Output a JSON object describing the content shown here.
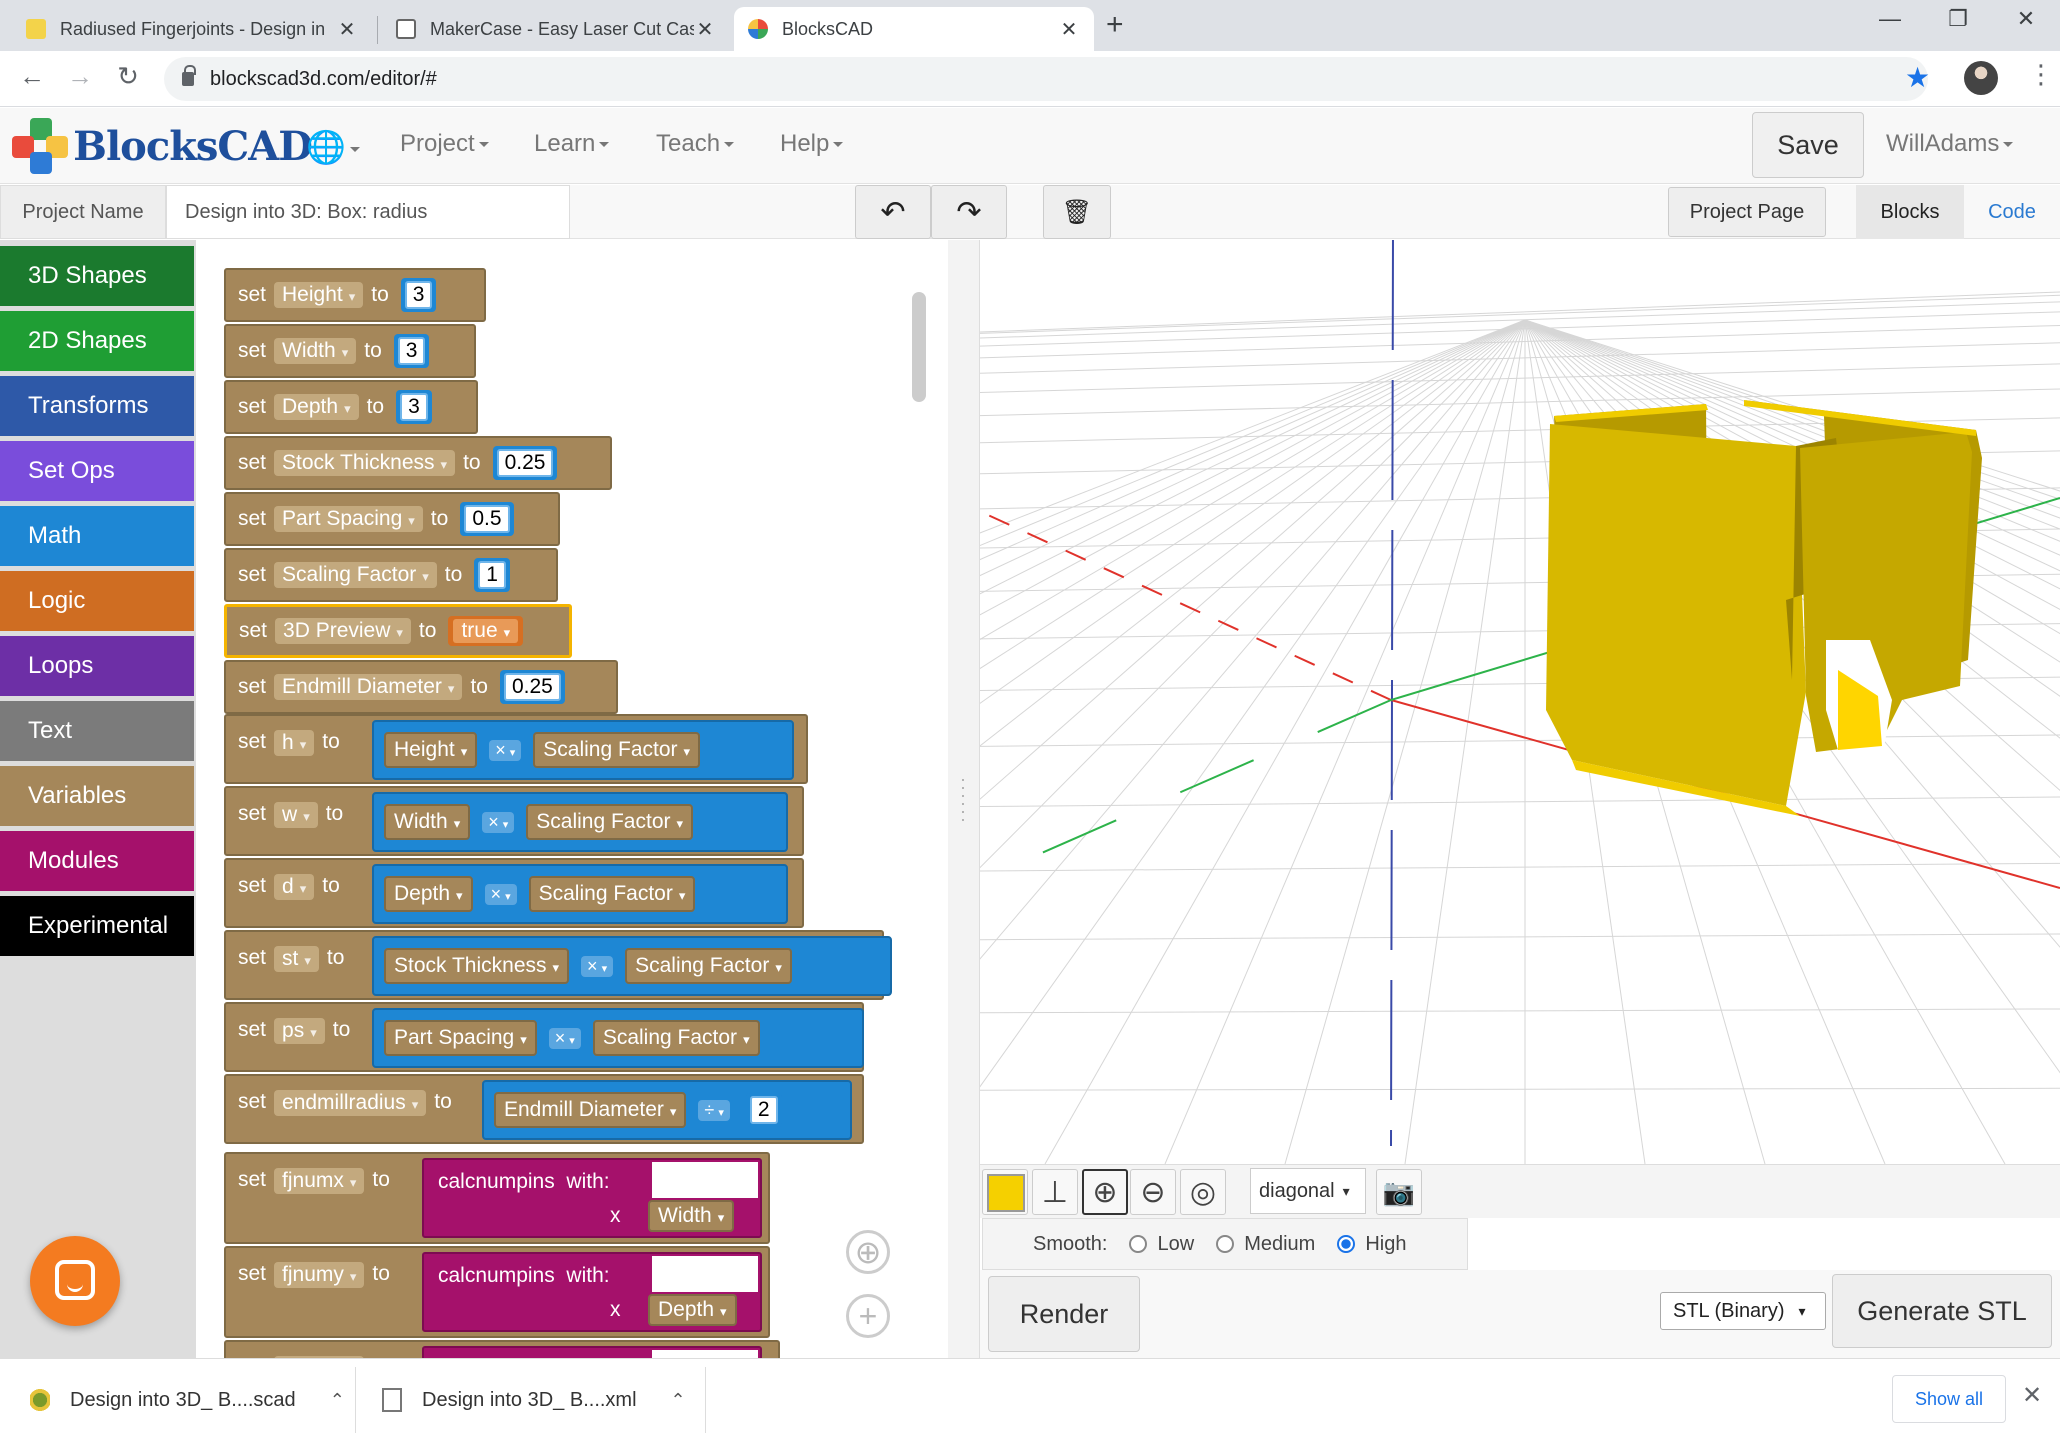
{
  "browser": {
    "tabs": [
      {
        "title": "Radiused Fingerjoints - Design in",
        "close": "✕"
      },
      {
        "title": "MakerCase - Easy Laser Cut Case",
        "close": "✕"
      },
      {
        "title": "BlocksCAD",
        "close": "✕"
      }
    ],
    "new_tab": "+",
    "window_controls": {
      "minimize": "—",
      "restore": "❐",
      "close": "✕"
    },
    "nav": {
      "back": "←",
      "forward": "→",
      "reload": "↻"
    },
    "url": "blockscad3d.com/editor/#",
    "star": "★",
    "menu": "⋮"
  },
  "app": {
    "logo_text": "BlocksCAD",
    "globe": "🌐",
    "menus": [
      "Project",
      "Learn",
      "Teach",
      "Help"
    ],
    "save_label": "Save",
    "username": "WillAdams"
  },
  "project": {
    "label": "Project Name",
    "name": "Design into 3D: Box: radius",
    "undo": "↶",
    "redo": "↷",
    "trash": "🗑",
    "page_button": "Project Page",
    "tab_blocks": "Blocks",
    "tab_code": "Code"
  },
  "categories": [
    {
      "label": "3D Shapes",
      "color": "#1b7a2e"
    },
    {
      "label": "2D Shapes",
      "color": "#1f9e34"
    },
    {
      "label": "Transforms",
      "color": "#2e59a8"
    },
    {
      "label": "Set Ops",
      "color": "#7a4ddb"
    },
    {
      "label": "Math",
      "color": "#1e87d4"
    },
    {
      "label": "Logic",
      "color": "#cf6d22"
    },
    {
      "label": "Loops",
      "color": "#6d2fa6"
    },
    {
      "label": "Text",
      "color": "#7b7b7b"
    },
    {
      "label": "Variables",
      "color": "#a5875a"
    },
    {
      "label": "Modules",
      "color": "#a5116b"
    },
    {
      "label": "Experimental",
      "color": "#000000"
    }
  ],
  "blocks": {
    "kw_set": "set",
    "kw_to": "to",
    "kw_with": "with:",
    "kw_x": "x",
    "simple": [
      {
        "var": "Height",
        "value": "3"
      },
      {
        "var": "Width",
        "value": "3"
      },
      {
        "var": "Depth",
        "value": "3"
      },
      {
        "var": "Stock Thickness",
        "value": "0.25"
      },
      {
        "var": "Part Spacing",
        "value": "0.5"
      },
      {
        "var": "Scaling Factor",
        "value": "1"
      },
      {
        "var": "3D Preview",
        "value": "true"
      },
      {
        "var": "Endmill Diameter",
        "value": "0.25"
      }
    ],
    "math": [
      {
        "var": "h",
        "a": "Height",
        "op": "×",
        "b": "Scaling Factor"
      },
      {
        "var": "w",
        "a": "Width",
        "op": "×",
        "b": "Scaling Factor"
      },
      {
        "var": "d",
        "a": "Depth",
        "op": "×",
        "b": "Scaling Factor"
      },
      {
        "var": "st",
        "a": "Stock Thickness",
        "op": "×",
        "b": "Scaling Factor"
      },
      {
        "var": "ps",
        "a": "Part Spacing",
        "op": "×",
        "b": "Scaling Factor"
      },
      {
        "var": "endmillradius",
        "a": "Endmill Diameter",
        "op": "÷",
        "b": "2"
      }
    ],
    "calls": [
      {
        "var": "fjnumx",
        "fn": "calcnumpins",
        "arg": "Width"
      },
      {
        "var": "fjnumy",
        "fn": "calcnumpins",
        "arg": "Depth"
      },
      {
        "var": "fjnumz",
        "fn": "calcnumpins",
        "arg": ""
      }
    ]
  },
  "workspace_controls": {
    "recenter": "⊕",
    "zoom_in": "+"
  },
  "viewer": {
    "model_color": "#f5d000",
    "tools": {
      "axes": "⊥",
      "zoom_in": "⊕",
      "zoom_out": "⊖",
      "target": "◎",
      "camera": "📷"
    },
    "view_option": "diagonal",
    "smooth_label": "Smooth:",
    "smooth_options": [
      "Low",
      "Medium",
      "High"
    ],
    "smooth_selected": "High",
    "render_label": "Render",
    "format": "STL (Binary)",
    "generate_label": "Generate STL"
  },
  "downloads": [
    {
      "name": "Design into 3D_ B....scad"
    },
    {
      "name": "Design into 3D_ B....xml"
    }
  ],
  "shelf": {
    "show_all": "Show all",
    "close": "✕",
    "chevron": "⌃"
  }
}
